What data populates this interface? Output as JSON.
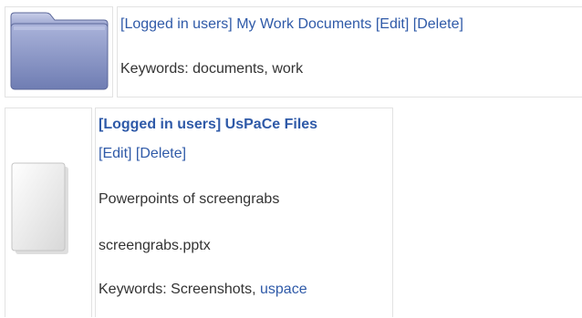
{
  "folder": {
    "icon": "folder-icon",
    "access": "[Logged in users]",
    "name": "My Work Documents",
    "edit_label": "[Edit]",
    "delete_label": "[Delete]",
    "keywords_label": "Keywords:",
    "keywords": "documents, work"
  },
  "file": {
    "icon": "document-icon",
    "title": "[Logged in users] UsPaCe Files",
    "edit_label": "[Edit]",
    "delete_label": "[Delete]",
    "description": "Powerpoints of screengrabs",
    "filename": "screengrabs.pptx",
    "keywords_label": "Keywords:",
    "keyword_plain": "Screenshots,",
    "keyword_link": "uspace"
  },
  "colors": {
    "link": "#2f5aa8",
    "text": "#333333",
    "folder_fill": "#8a97c6",
    "border": "#e2e2e2"
  }
}
